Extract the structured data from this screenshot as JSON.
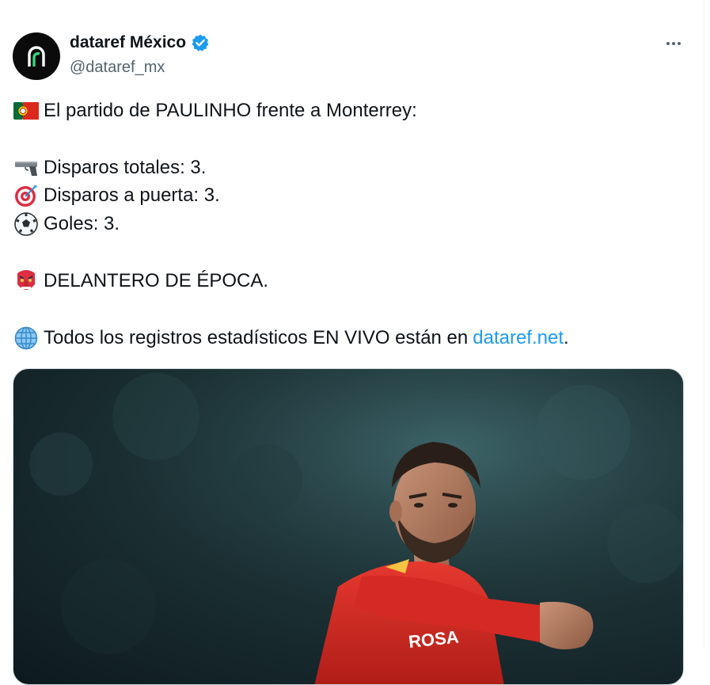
{
  "author": {
    "name": "dataref México",
    "handle": "@dataref_mx",
    "verified": true
  },
  "menu": {
    "icon": "more-horizontal-icon"
  },
  "tweet": {
    "lines": [
      {
        "emoji": "portugal-flag-icon",
        "text": "El partido de PAULINHO frente a Monterrey:"
      },
      {
        "emoji": "pistol-icon",
        "text": "Disparos totales: 3."
      },
      {
        "emoji": "direct-hit-icon",
        "text": "Disparos a puerta: 3."
      },
      {
        "emoji": "soccer-ball-icon",
        "text": "Goles: 3."
      },
      {
        "emoji": "goblin-mask-icon",
        "text": "DELANTERO DE ÉPOCA."
      },
      {
        "emoji": "globe-icon",
        "text": "Todos los registros estadísticos EN VIVO están en",
        "link": "dataref.net",
        "suffix": "."
      }
    ]
  },
  "media": {
    "jersey_text": "ROSA"
  },
  "colors": {
    "accent": "#1d9bf0",
    "text": "#0f1419",
    "secondary": "#536471",
    "jersey": "#d42a24"
  }
}
